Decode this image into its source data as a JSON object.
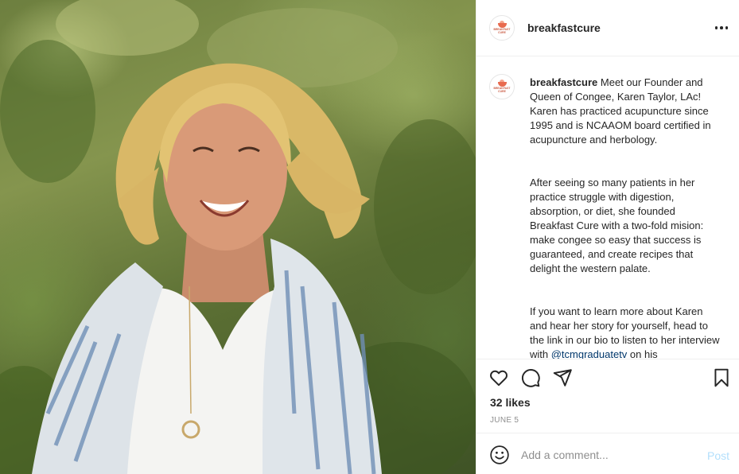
{
  "post": {
    "username": "breakfastcure",
    "avatar_text": "BREAKFAST CURE",
    "photo_alt_icon": "photo-of-smiling-woman",
    "caption": {
      "username": "breakfastcure",
      "paragraph1": " Meet our Founder and Queen of Congee, Karen Taylor, LAc! Karen has practiced acupuncture since 1995 and is NCAAOM board certified in acupuncture and herbology.",
      "paragraph2": "After seeing so many patients in her practice struggle with digestion, absorption, or diet, she founded Breakfast Cure with a two-fold mision: make congee so easy that success is guaranteed, and create recipes that delight the western palate.",
      "paragraph3_pre": "If you want to learn more about Karen and hear her story for yourself, head to the link in our bio to listen to her interview with ",
      "mention": "@tcmgraduatetv",
      "paragraph3_post": " on his"
    },
    "likes": "32 likes",
    "date": "JUNE 5"
  },
  "icons": {
    "like": "heart-icon",
    "comment": "comment-icon",
    "share": "share-icon",
    "save": "bookmark-icon",
    "more": "more-options-icon",
    "emoji": "emoji-icon"
  },
  "comment": {
    "placeholder": "Add a comment...",
    "post_label": "Post"
  },
  "colors": {
    "text": "#262626",
    "muted": "#8e8e8e",
    "post_disabled": "#b2dffc",
    "border": "#efefef",
    "brand": "#e86a4e"
  }
}
